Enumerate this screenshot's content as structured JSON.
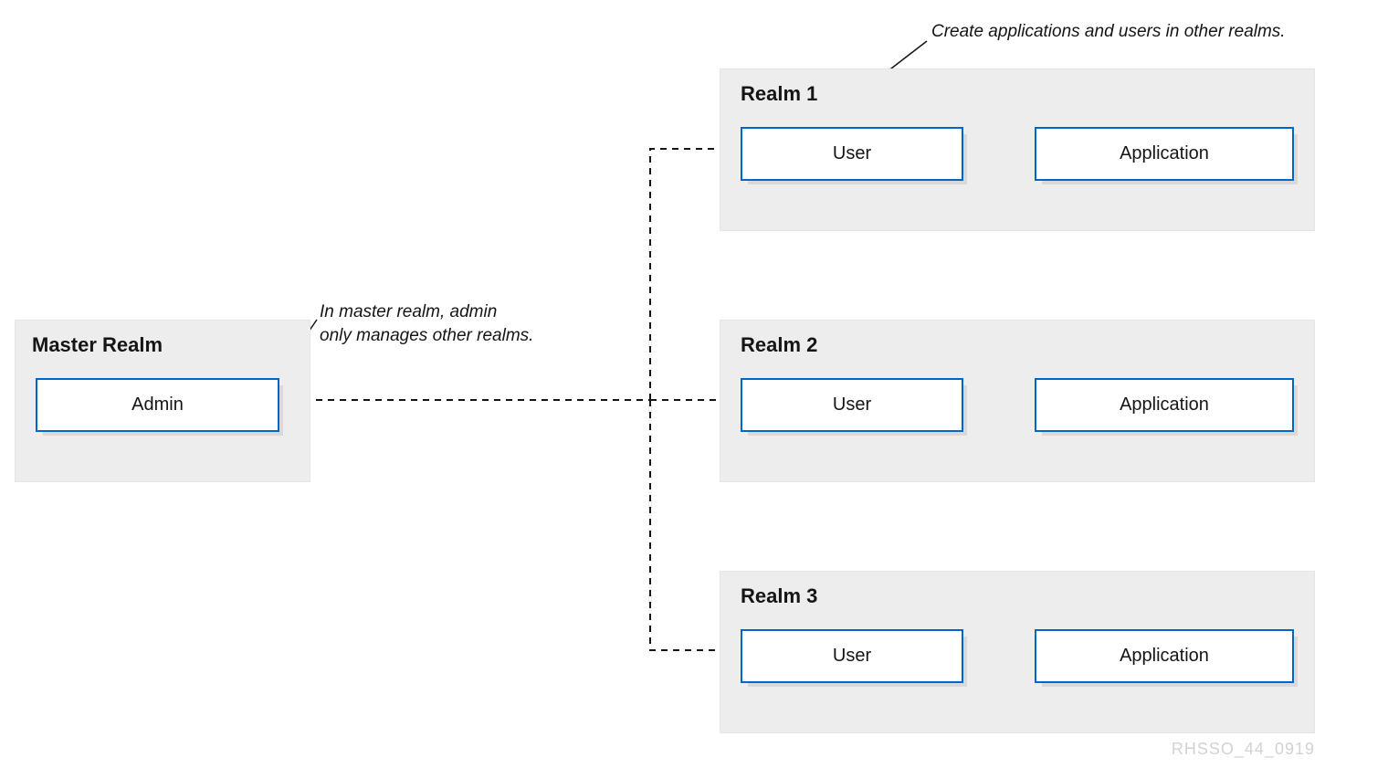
{
  "master_realm": {
    "title": "Master Realm",
    "admin_label": "Admin"
  },
  "realms": [
    {
      "title": "Realm 1",
      "user": "User",
      "app": "Application"
    },
    {
      "title": "Realm 2",
      "user": "User",
      "app": "Application"
    },
    {
      "title": "Realm 3",
      "user": "User",
      "app": "Application"
    }
  ],
  "annotations": {
    "master": "In master realm, admin\nonly manages other realms.",
    "realms": "Create applications and users in other realms."
  },
  "footer_id": "RHSSO_44_0919"
}
